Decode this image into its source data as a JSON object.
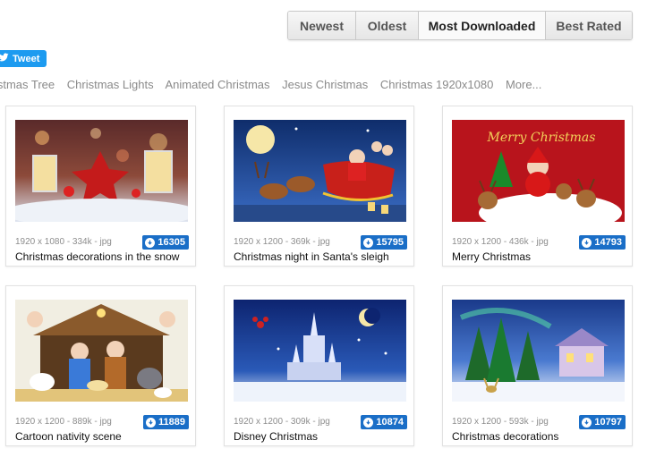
{
  "sort_tabs": [
    {
      "label": "Newest",
      "active": false
    },
    {
      "label": "Oldest",
      "active": false
    },
    {
      "label": "Most Downloaded",
      "active": true
    },
    {
      "label": "Best Rated",
      "active": false
    }
  ],
  "tweet_label": "Tweet",
  "tags": [
    "Christmas Tree",
    "Christmas Lights",
    "Animated Christmas",
    "Jesus Christmas",
    "Christmas 1920x1080",
    "More..."
  ],
  "cards": [
    {
      "meta": "1920 x 1080 - 334k - jpg",
      "downloads": "16305",
      "title": "Christmas decorations in the snow"
    },
    {
      "meta": "1920 x 1200 - 369k - jpg",
      "downloads": "15795",
      "title": "Christmas night in Santa's sleigh"
    },
    {
      "meta": "1920 x 1200 - 436k - jpg",
      "downloads": "14793",
      "title": "Merry Christmas",
      "image_text": "Merry Christmas"
    },
    {
      "meta": "1920 x 1200 - 889k - jpg",
      "downloads": "11889",
      "title": "Cartoon nativity scene"
    },
    {
      "meta": "1920 x 1200 - 309k - jpg",
      "downloads": "10874",
      "title": "Disney Christmas"
    },
    {
      "meta": "1920 x 1200 - 593k - jpg",
      "downloads": "10797",
      "title": "Christmas decorations"
    }
  ],
  "colors": {
    "badge": "#1a6ec7",
    "tweet": "#1d9bf0"
  }
}
